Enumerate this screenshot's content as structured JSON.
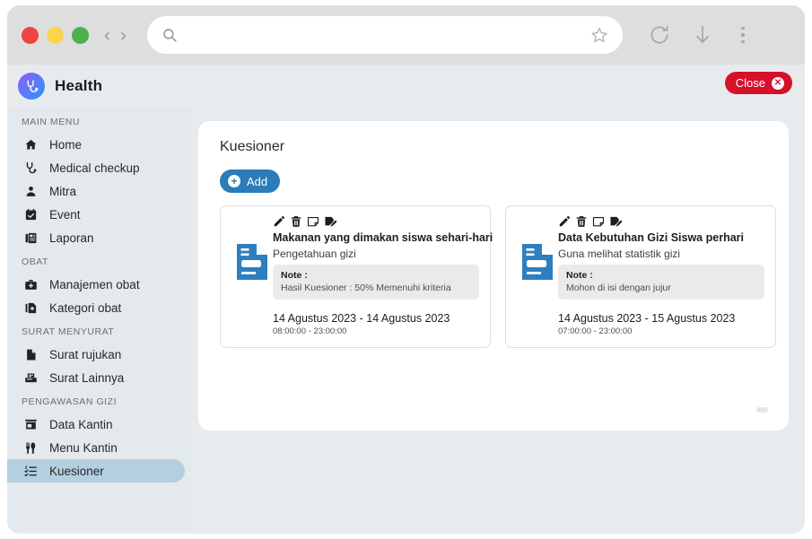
{
  "browser": {
    "url_value": "",
    "url_placeholder": "",
    "back_glyph": "‹",
    "forward_glyph": "›",
    "icons": [
      "search-icon",
      "star-icon",
      "reload-icon",
      "download-icon",
      "menu-kebab-icon"
    ]
  },
  "header": {
    "brand": "Health",
    "logo_icon": "stethoscope-icon",
    "close_label": "Close",
    "close_icon": "close-circle-icon",
    "close_color": "#d6112a"
  },
  "sidebar": {
    "sections": [
      {
        "label": "MAIN MENU",
        "items": [
          {
            "label": "Home",
            "icon": "home-icon",
            "active": false
          },
          {
            "label": "Medical checkup",
            "icon": "stethoscope-icon",
            "active": false
          },
          {
            "label": "Mitra",
            "icon": "user-icon",
            "active": false
          },
          {
            "label": "Event",
            "icon": "calendar-check-icon",
            "active": false
          },
          {
            "label": "Laporan",
            "icon": "newspaper-icon",
            "active": false
          }
        ]
      },
      {
        "label": "OBAT",
        "items": [
          {
            "label": "Manajemen obat",
            "icon": "briefcase-medical-icon",
            "active": false
          },
          {
            "label": "Kategori obat",
            "icon": "file-medical-icon",
            "active": false
          }
        ]
      },
      {
        "label": "SURAT MENYURAT",
        "items": [
          {
            "label": "Surat rujukan",
            "icon": "file-icon",
            "active": false
          },
          {
            "label": "Surat Lainnya",
            "icon": "fax-icon",
            "active": false
          }
        ]
      },
      {
        "label": "PENGAWASAN GIZI",
        "items": [
          {
            "label": "Data Kantin",
            "icon": "store-icon",
            "active": false
          },
          {
            "label": "Menu Kantin",
            "icon": "utensils-icon",
            "active": false
          },
          {
            "label": "Kuesioner",
            "icon": "list-check-icon",
            "active": true
          }
        ]
      }
    ],
    "active_color": "#b4cfdf"
  },
  "main": {
    "title": "Kuesioner",
    "add_label": "Add",
    "add_icon": "plus-circle-icon",
    "add_color": "#2b7cb9",
    "card_actions": [
      "edit-pencil-icon",
      "trash-icon",
      "note-icon",
      "edit-document-icon"
    ],
    "note_label": "Note :",
    "cards": [
      {
        "title": "Makanan yang dimakan siswa sehari-hari",
        "subtitle": "Pengetahuan gizi",
        "note": "Hasil Kuesioner : 50% Memenuhi kriteria",
        "date_range": "14 Agustus 2023 - 14 Agustus 2023",
        "time_range": "08:00:00 - 23:00:00",
        "doc_icon": "document-icon"
      },
      {
        "title": "Data Kebutuhan Gizi Siswa perhari",
        "subtitle": "Guna melihat statistik gizi",
        "note": "Mohon di isi dengan jujur",
        "date_range": "14 Agustus 2023 - 15 Agustus 2023",
        "time_range": "07:00:00 - 23:00:00",
        "doc_icon": "document-icon"
      }
    ]
  }
}
